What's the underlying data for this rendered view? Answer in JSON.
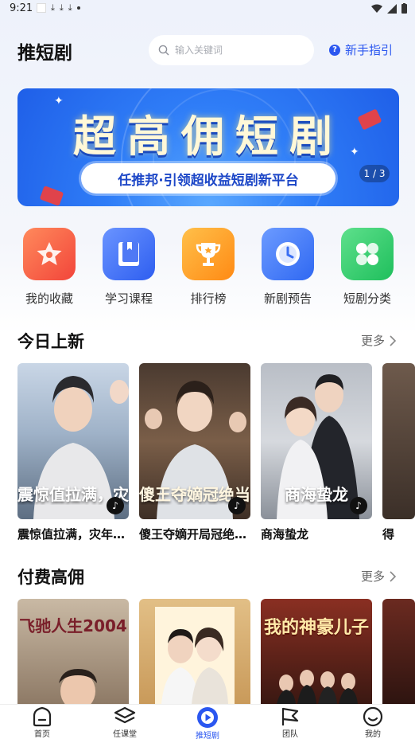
{
  "status_bar": {
    "time": "9:21",
    "download_glyph": "⤓"
  },
  "header": {
    "title": "推短剧",
    "search": {
      "placeholder": "输入关键词",
      "value": ""
    },
    "guide_label": "新手指引",
    "guide_icon": "?"
  },
  "banner": {
    "title": "超高佣短剧",
    "subtitle": "任推邦·引领超收益短剧新平台",
    "pager": "1 / 3"
  },
  "quick_menu": [
    {
      "label": "我的收藏",
      "icon": "star-icon",
      "color": "#f2543f"
    },
    {
      "label": "学习课程",
      "icon": "book-icon",
      "color": "#3a6cf2"
    },
    {
      "label": "排行榜",
      "icon": "trophy-icon",
      "color": "#ff9a1f"
    },
    {
      "label": "新剧预告",
      "icon": "clock-icon",
      "color": "#3a72f5"
    },
    {
      "label": "短剧分类",
      "icon": "category-icon",
      "color": "#2ec96a"
    }
  ],
  "today_new": {
    "title": "今日上新",
    "more": "更多",
    "items": [
      {
        "title": "震惊值拉满，灾年我靠系统…",
        "poster_text": "震惊值拉满，灾荒年我靠系统",
        "tiktok_glyph": "♪"
      },
      {
        "title": "傻王夺嫡开局冠绝当世",
        "poster_text": "傻王夺嫡冠绝当",
        "tiktok_glyph": "♪"
      },
      {
        "title": "商海蛰龙",
        "poster_text": "商海蛰龙",
        "tiktok_glyph": "♪"
      },
      {
        "title": "得"
      }
    ]
  },
  "paid_high": {
    "title": "付费高佣",
    "more": "更多",
    "items": [
      {
        "poster_text": "飞驰人生2004"
      },
      {
        "poster_text": ""
      },
      {
        "poster_text": "我的神豪儿子"
      },
      {
        "poster_text": ""
      }
    ]
  },
  "bottom_nav": [
    {
      "label": "首页",
      "icon": "home-icon"
    },
    {
      "label": "任课堂",
      "icon": "classroom-icon"
    },
    {
      "label": "推短剧",
      "icon": "play-icon",
      "active": true
    },
    {
      "label": "团队",
      "icon": "team-flag-icon"
    },
    {
      "label": "我的",
      "icon": "profile-smile-icon"
    }
  ],
  "colors": {
    "accent": "#2b57f0",
    "banner_blue": "#2f7df7"
  }
}
